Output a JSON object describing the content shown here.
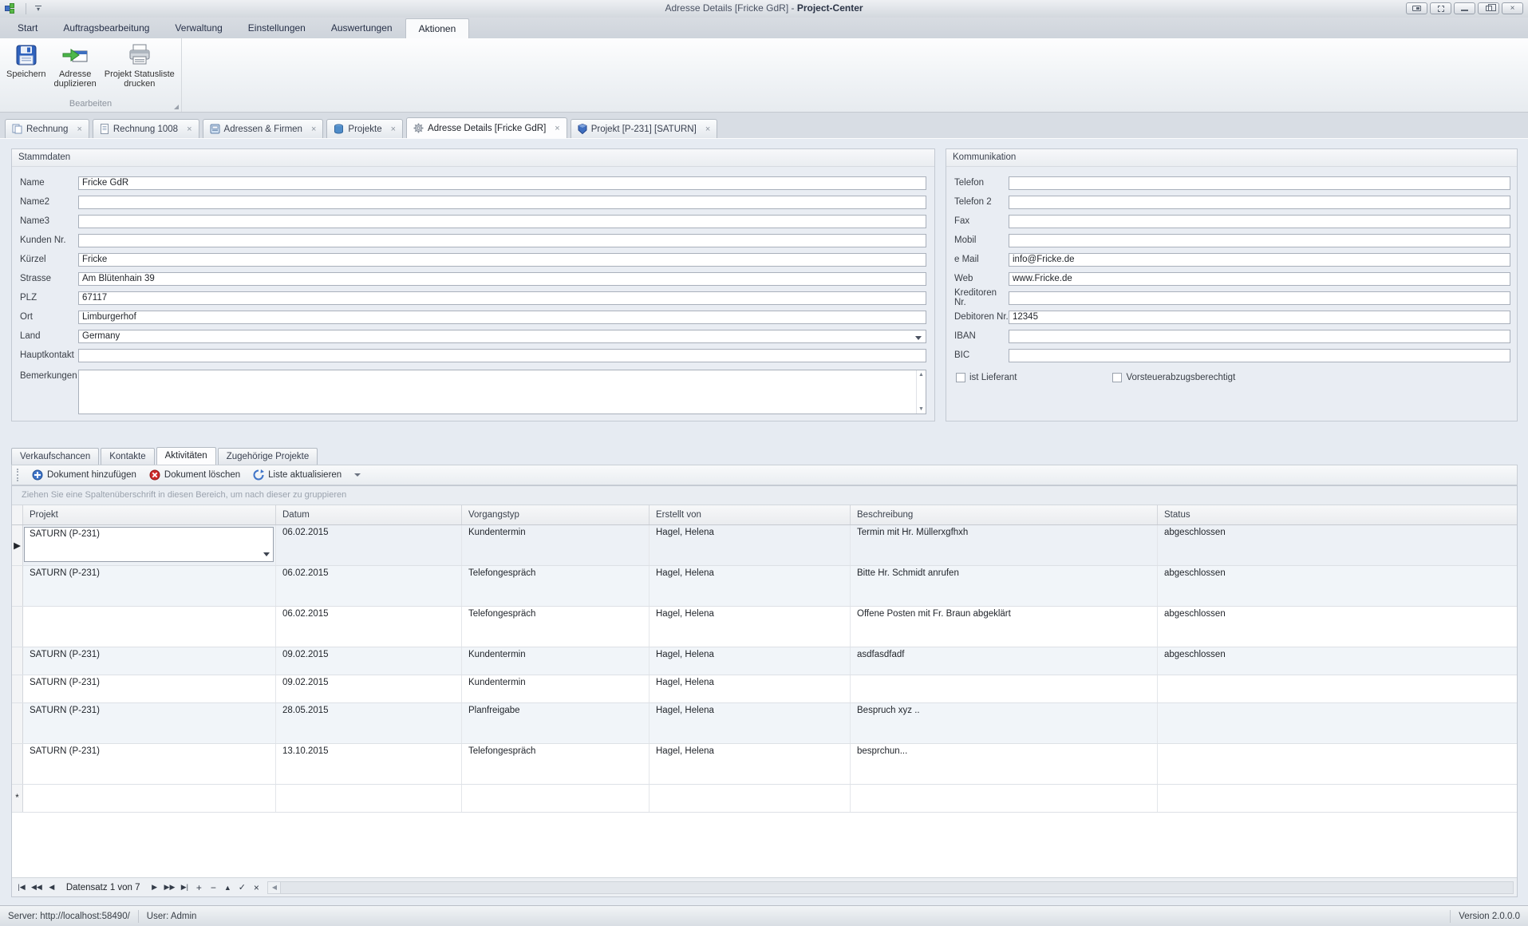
{
  "titlebar": {
    "title_prefix": "Adresse Details [Fricke GdR] -  ",
    "title_app": "Project-Center"
  },
  "icons": {
    "close": "×",
    "check": "✓"
  },
  "ribbon": {
    "tabs": [
      "Start",
      "Auftragsbearbeitung",
      "Verwaltung",
      "Einstellungen",
      "Auswertungen",
      "Aktionen"
    ],
    "active_tab": "Aktionen",
    "group": {
      "label": "Bearbeiten",
      "buttons": [
        {
          "line1": "Speichern",
          "line2": "",
          "icon": "save-icon"
        },
        {
          "line1": "Adresse",
          "line2": "duplizieren",
          "icon": "duplicate-address-icon"
        },
        {
          "line1": "Projekt Statusliste",
          "line2": "drucken",
          "icon": "printer-icon"
        }
      ]
    }
  },
  "doc_tabs": [
    {
      "label": "Rechnung",
      "icon": "copy-page-icon"
    },
    {
      "label": "Rechnung 1008",
      "icon": "document-icon"
    },
    {
      "label": "Adressen & Firmen",
      "icon": "address-book-icon"
    },
    {
      "label": "Projekte",
      "icon": "database-icon"
    },
    {
      "label": "Adresse Details [Fricke GdR]",
      "icon": "gear-icon",
      "active": true
    },
    {
      "label": "Projekt [P-231] [SATURN]",
      "icon": "project-cube-icon"
    }
  ],
  "stammdaten": {
    "title": "Stammdaten",
    "fields": [
      {
        "label": "Name",
        "value": "Fricke GdR"
      },
      {
        "label": "Name2",
        "value": ""
      },
      {
        "label": "Name3",
        "value": ""
      },
      {
        "label": "Kunden Nr.",
        "value": ""
      },
      {
        "label": "Kürzel",
        "value": "Fricke"
      },
      {
        "label": "Strasse",
        "value": "Am Blütenhain 39"
      },
      {
        "label": "PLZ",
        "value": "67117"
      },
      {
        "label": "Ort",
        "value": "Limburgerhof"
      },
      {
        "label": "Land",
        "value": "Germany"
      },
      {
        "label": "Hauptkontakt",
        "value": ""
      }
    ],
    "memo_label": "Bemerkungen",
    "memo_value": ""
  },
  "kommunikation": {
    "title": "Kommunikation",
    "fields": [
      {
        "label": "Telefon",
        "value": ""
      },
      {
        "label": "Telefon 2",
        "value": ""
      },
      {
        "label": "Fax",
        "value": ""
      },
      {
        "label": "Mobil",
        "value": ""
      },
      {
        "label": "e Mail",
        "value": "info@Fricke.de"
      },
      {
        "label": "Web",
        "value": "www.Fricke.de"
      },
      {
        "label": "Kreditoren Nr.",
        "value": ""
      },
      {
        "label": "Debitoren Nr.",
        "value": "12345"
      },
      {
        "label": "IBAN",
        "value": ""
      },
      {
        "label": "BIC",
        "value": ""
      }
    ],
    "checkboxes": [
      {
        "label": "ist Lieferant",
        "checked": false
      },
      {
        "label": "Vorsteuerabzugsberechtigt",
        "checked": false
      }
    ]
  },
  "detail_tabs": [
    "Verkaufschancen",
    "Kontakte",
    "Aktivitäten",
    "Zugehörige Projekte"
  ],
  "detail_active_tab": "Aktivitäten",
  "toolbar": {
    "buttons": [
      {
        "label": "Dokument hinzufügen",
        "icon": "add-circle-icon"
      },
      {
        "label": "Dokument löschen",
        "icon": "delete-circle-icon"
      },
      {
        "label": "Liste aktualisieren",
        "icon": "refresh-icon"
      }
    ]
  },
  "grid": {
    "group_hint": "Ziehen Sie eine Spaltenüberschrift in diesen Bereich, um nach dieser zu gruppieren",
    "columns": [
      "Projekt",
      "Datum",
      "Vorgangstyp",
      "Erstellt von",
      "Beschreibung",
      "Status"
    ],
    "indicators": {
      "selected": "▶",
      "new": "*"
    },
    "rows": [
      {
        "projekt": "SATURN (P-231)",
        "datum": "06.02.2015",
        "vorgangstyp": "Kundentermin",
        "erstellt": "Hagel, Helena",
        "beschreibung": "Termin mit Hr. Müllerxgfhxh",
        "status": "abgeschlossen"
      },
      {
        "projekt": "SATURN (P-231)",
        "datum": "06.02.2015",
        "vorgangstyp": "Telefongespräch",
        "erstellt": "Hagel, Helena",
        "beschreibung": "Bitte Hr. Schmidt anrufen",
        "status": "abgeschlossen"
      },
      {
        "projekt": "",
        "datum": "06.02.2015",
        "vorgangstyp": "Telefongespräch",
        "erstellt": "Hagel, Helena",
        "beschreibung": "Offene Posten mit Fr. Braun abgeklärt",
        "status": "abgeschlossen"
      },
      {
        "projekt": "SATURN (P-231)",
        "datum": "09.02.2015",
        "vorgangstyp": "Kundentermin",
        "erstellt": "Hagel, Helena",
        "beschreibung": "asdfasdfadf",
        "status": "abgeschlossen"
      },
      {
        "projekt": "SATURN (P-231)",
        "datum": "09.02.2015",
        "vorgangstyp": "Kundentermin",
        "erstellt": "Hagel, Helena",
        "beschreibung": "",
        "status": ""
      },
      {
        "projekt": "SATURN (P-231)",
        "datum": "28.05.2015",
        "vorgangstyp": "Planfreigabe",
        "erstellt": "Hagel, Helena",
        "beschreibung": "Bespruch xyz ..",
        "status": ""
      },
      {
        "projekt": "SATURN (P-231)",
        "datum": "13.10.2015",
        "vorgangstyp": "Telefongespräch",
        "erstellt": "Hagel, Helena",
        "beschreibung": "besprchun...",
        "status": ""
      }
    ],
    "navigator": {
      "record_text": "Datensatz 1 von 7",
      "buttons": [
        {
          "name": "first-record-button",
          "glyph": "|◀"
        },
        {
          "name": "prev-page-button",
          "glyph": "◀◀"
        },
        {
          "name": "prev-record-button",
          "glyph": "◀"
        },
        {
          "name": "next-record-button",
          "glyph": "▶"
        },
        {
          "name": "next-page-button",
          "glyph": "▶▶"
        },
        {
          "name": "last-record-button",
          "glyph": "▶|"
        },
        {
          "name": "append-record-button",
          "glyph": "+"
        },
        {
          "name": "delete-record-button",
          "glyph": "−"
        },
        {
          "name": "edit-record-button",
          "glyph": "▲"
        },
        {
          "name": "post-edit-button",
          "glyph": "✓"
        },
        {
          "name": "cancel-edit-button",
          "glyph": "×"
        },
        {
          "name": "hscroll-left-button",
          "glyph": "◀"
        }
      ]
    }
  },
  "statusbar": {
    "server": "Server: http://localhost:58490/",
    "user": "User: Admin",
    "version": "Version 2.0.0.0"
  }
}
